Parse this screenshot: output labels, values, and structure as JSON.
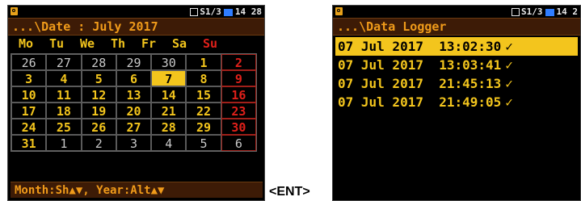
{
  "left_screen": {
    "status": {
      "text": "S1/3",
      "time": "14 28"
    },
    "title": "...\\Date : July 2017",
    "weekdays": [
      "Mo",
      "Tu",
      "We",
      "Th",
      "Fr",
      "Sa",
      "Su"
    ],
    "weeks": [
      [
        "26",
        "27",
        "28",
        "29",
        "30",
        "1",
        "2"
      ],
      [
        "3",
        "4",
        "5",
        "6",
        "7",
        "8",
        "9"
      ],
      [
        "10",
        "11",
        "12",
        "13",
        "14",
        "15",
        "16"
      ],
      [
        "17",
        "18",
        "19",
        "20",
        "21",
        "22",
        "23"
      ],
      [
        "24",
        "25",
        "26",
        "27",
        "28",
        "29",
        "30"
      ],
      [
        "31",
        "1",
        "2",
        "3",
        "4",
        "5",
        "6"
      ]
    ],
    "selected_day": "7",
    "hint": "Month:Sh▲▼, Year:Alt▲▼"
  },
  "right_screen": {
    "status": {
      "text": "S1/3",
      "time": "14 2"
    },
    "title": "...\\Data Logger",
    "entries": [
      {
        "date": "07 Jul 2017",
        "time": "13:02:30",
        "check": "✓",
        "selected": true
      },
      {
        "date": "07 Jul 2017",
        "time": "13:03:41",
        "check": "✓",
        "selected": false
      },
      {
        "date": "07 Jul 2017",
        "time": "21:45:13",
        "check": "✓",
        "selected": false
      },
      {
        "date": "07 Jul 2017",
        "time": "21:49:05",
        "check": "✓",
        "selected": false
      }
    ]
  },
  "arrow_label": "<ENT>",
  "colors": {
    "accent_yellow": "#f3c51d",
    "accent_orange": "#f09b1a",
    "sunday_red": "#e0201a",
    "battery_blue": "#2f7dff"
  }
}
